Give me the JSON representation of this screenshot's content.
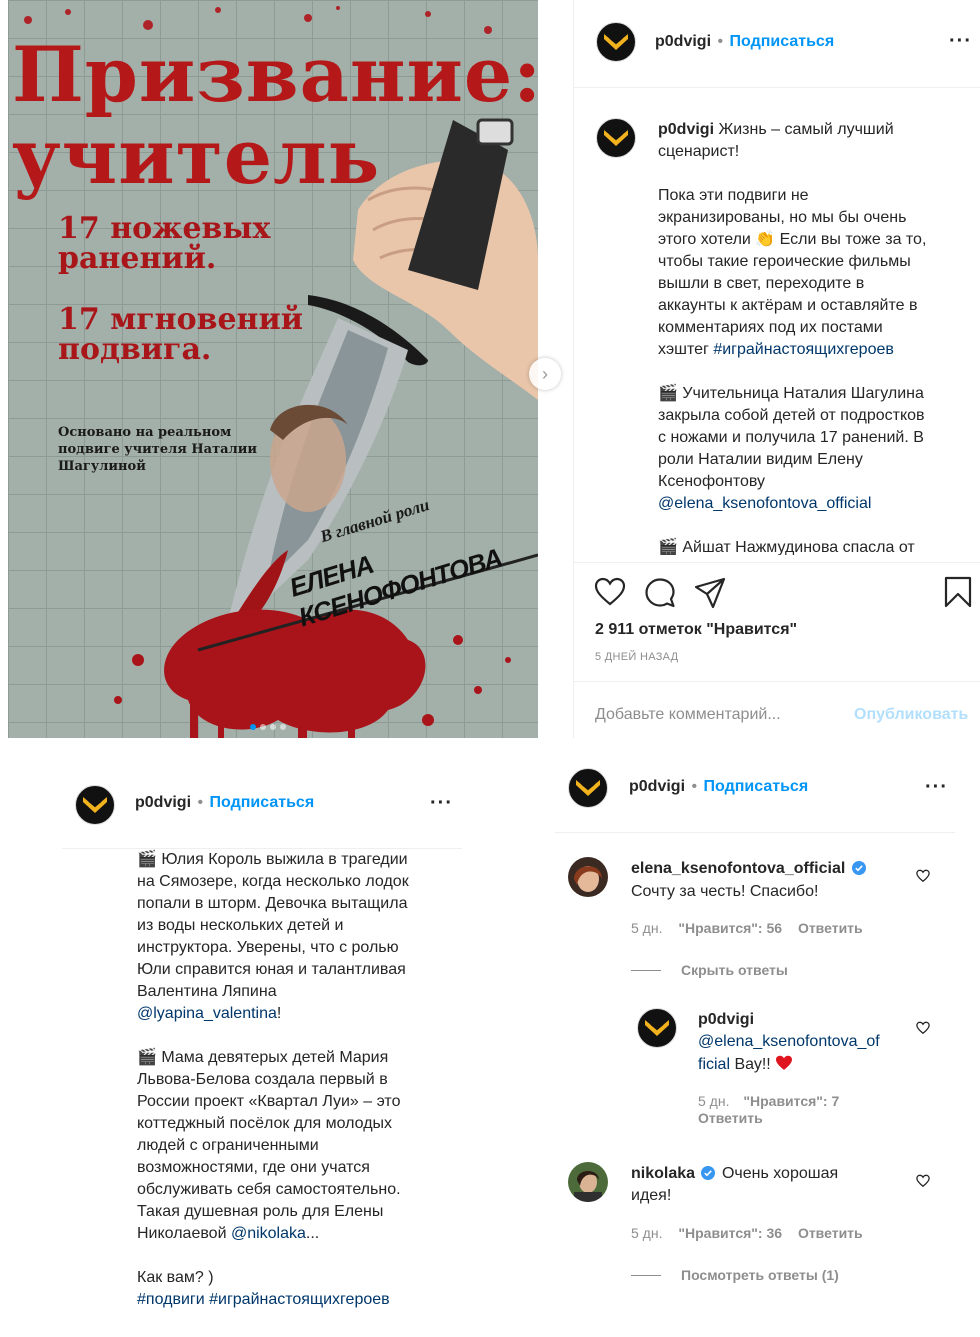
{
  "poster": {
    "title_line_1": "Призвание:",
    "title_line_2": "учитель",
    "tagline_1": "17 ножевых ранений.",
    "tagline_2": "17 мгновений подвига.",
    "based_on": "Основано на реальном подвиге учителя Наталии Шагулиной",
    "starring_label": "В главной роли",
    "starring_name": "ЕЛЕНА КСЕНОФОНТОВА",
    "carousel_next_icon": "chevron-right-icon",
    "slides": 4,
    "active_slide": 1
  },
  "post": {
    "username": "p0dvigi",
    "separator": "•",
    "follow_label": "Подписаться",
    "more_icon": "more-horizontal-icon",
    "caption_lines": [
      {
        "user": "p0dvigi",
        "text": " Жизнь – самый лучший"
      },
      {
        "text": "сценарист!"
      },
      {
        "text": ""
      },
      {
        "text": "Пока эти подвиги не"
      },
      {
        "text": "экранизированы, но мы бы очень"
      },
      {
        "text": "этого хотели 👏 Если вы тоже за то,"
      },
      {
        "text": "чтобы такие героические фильмы"
      },
      {
        "text": "вышли в свет, переходите в"
      },
      {
        "text": "аккаунты к актёрам и оставляйте в"
      },
      {
        "text": "комментариях под их постами"
      },
      {
        "text": "хэштег ",
        "link": "#играйнастоящихгероев"
      },
      {
        "text": ""
      },
      {
        "text": "🎬 Учительница Наталия Шагулина"
      },
      {
        "text": "закрыла собой детей от подростков"
      },
      {
        "text": "с ножами и получила 17 ранений. В"
      },
      {
        "text": "роли Наталии видим Елену"
      },
      {
        "text": "Ксенофонтову"
      },
      {
        "link": "@elena_ksenofontova_official"
      },
      {
        "text": ""
      },
      {
        "text": "🎬 Айшат Нажмудинова спасла от"
      }
    ],
    "likes": "2 911 отметок \"Нравится\"",
    "date": "5 ДНЕЙ НАЗАД",
    "comment_placeholder": "Добавьте комментарий...",
    "publish_label": "Опубликовать"
  },
  "bottom_left": {
    "username": "p0dvigi",
    "separator": "•",
    "follow_label": "Подписаться",
    "lines": [
      {
        "text": "🎬 Юлия Король выжила в трагедии"
      },
      {
        "text": "на Сямозере, когда несколько лодок"
      },
      {
        "text": "попали в шторм. Девочка вытащила"
      },
      {
        "text": "из воды нескольких детей и"
      },
      {
        "text": "инструктора. Уверены, что с ролью"
      },
      {
        "text": "Юли справится юная и талантливая"
      },
      {
        "text": "Валентина Ляпина"
      },
      {
        "link": "@lyapina_valentina",
        "after": "!"
      },
      {
        "text": ""
      },
      {
        "text": "🎬 Мама девятерых детей Мария"
      },
      {
        "text": "Львова-Белова создала первый в"
      },
      {
        "text": "России проект «Квартал Луи» – это"
      },
      {
        "text": "коттеджный посёлок для молодых"
      },
      {
        "text": "людей с ограниченными"
      },
      {
        "text": "возможностями, где они учатся"
      },
      {
        "text": "обслуживать себя самостоятельно."
      },
      {
        "text": "Такая душевная роль для Елены"
      },
      {
        "text": "Николаевой ",
        "link": "@nikolaka",
        "after": "..."
      },
      {
        "text": ""
      },
      {
        "text": "Как вам? )"
      },
      {
        "link": "#подвиги #играйнастоящихгероев"
      }
    ]
  },
  "bottom_right": {
    "username": "p0dvigi",
    "separator": "•",
    "follow_label": "Подписаться",
    "comments": [
      {
        "user": "elena_ksenofontova_official",
        "verified": true,
        "text_1": "Сочту за честь! Спасибо!",
        "time": "5 дн.",
        "likes": "\"Нравится\": 56",
        "reply": "Ответить"
      },
      {
        "user": "nikolaka",
        "verified": true,
        "text_inline": "Очень хорошая",
        "text_2": "идея!",
        "time": "5 дн.",
        "likes": "\"Нравится\": 36",
        "reply": "Ответить"
      }
    ],
    "hide_replies": "Скрыть ответы",
    "reply": {
      "user": "p0dvigi",
      "mention_1": "@elena_ksenofontova_of",
      "mention_2": "ficial",
      "text": " Вау!!",
      "time": "5 дн.",
      "likes": "\"Нравится\": 7",
      "reply": "Ответить"
    },
    "view_replies": "Посмотреть ответы (1)"
  },
  "colors": {
    "accent": "#0095f6",
    "link": "#00376b",
    "muted": "#8e8e8e",
    "poster_red": "#b51818",
    "heart": "#ed4956"
  }
}
